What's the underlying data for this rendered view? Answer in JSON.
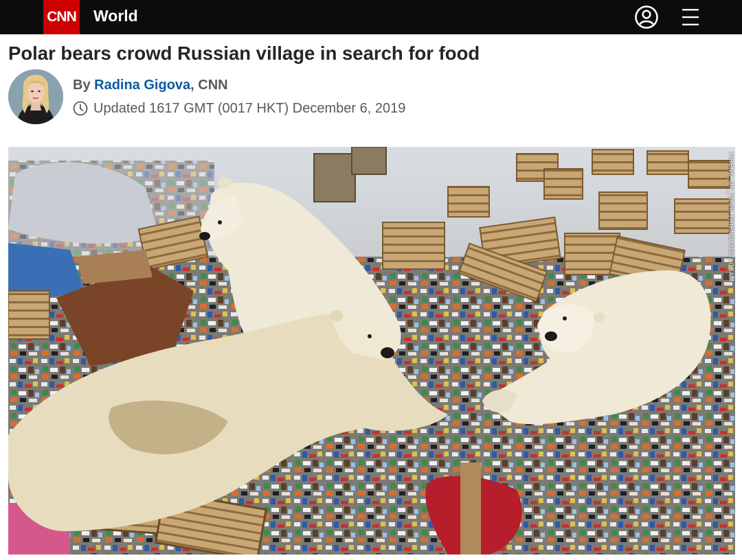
{
  "header": {
    "logo_text": "CNN",
    "section_label": "World",
    "icons": [
      "user-icon",
      "hamburger-menu-icon"
    ],
    "colors": {
      "bar": "#0c0c0c",
      "logo_bg": "#cc0000"
    }
  },
  "article": {
    "headline": "Polar bears crowd Russian village in search for food",
    "byline": {
      "prefix": "By ",
      "author": "Radina Gigova",
      "suffix": ", CNN"
    },
    "updated": "Updated 1617 GMT (0017 HKT) December 6, 2019",
    "photo": {
      "credit": "FRIEND_OF_YOUR_FRIEND/INSTAGRAM"
    },
    "colors": {
      "author_link": "#0c5aa0",
      "meta_text": "#595959"
    }
  }
}
